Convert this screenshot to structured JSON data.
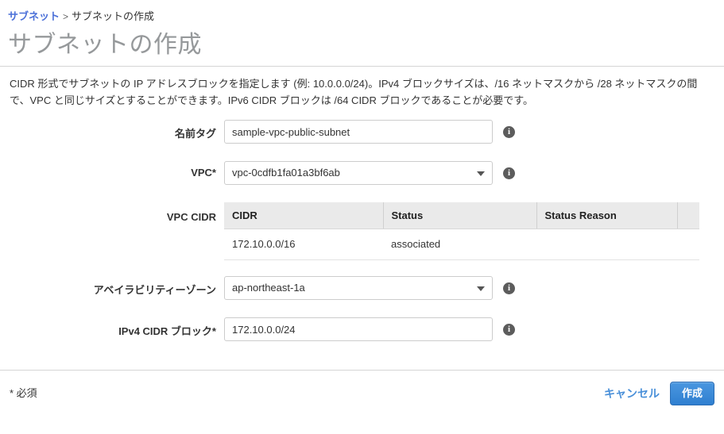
{
  "breadcrumb": {
    "parent_label": "サブネット",
    "separator": ">",
    "current_label": "サブネットの作成"
  },
  "page": {
    "title": "サブネットの作成",
    "description": "CIDR 形式でサブネットの IP アドレスブロックを指定します (例: 10.0.0.0/24)。IPv4 ブロックサイズは、/16 ネットマスクから /28 ネットマスクの間で、VPC と同じサイズとすることができます。IPv6 CIDR ブロックは /64 CIDR ブロックであることが必要です。"
  },
  "form": {
    "name_tag": {
      "label": "名前タグ",
      "value": "sample-vpc-public-subnet",
      "placeholder": "",
      "info": "i"
    },
    "vpc": {
      "label": "VPC*",
      "value": "vpc-0cdfb1fa01a3bf6ab",
      "info": "i"
    },
    "vpc_cidr": {
      "label": "VPC CIDR"
    },
    "availability_zone": {
      "label": "アベイラビリティーゾーン",
      "value": "ap-northeast-1a",
      "info": "i"
    },
    "ipv4_cidr_block": {
      "label": "IPv4 CIDR ブロック*",
      "value": "172.10.0.0/24",
      "placeholder": "",
      "info": "i"
    }
  },
  "cidr_table": {
    "columns": [
      "CIDR",
      "Status",
      "Status Reason",
      ""
    ],
    "rows": [
      {
        "cidr": "172.10.0.0/16",
        "status": "associated",
        "status_reason": "",
        "extra": ""
      }
    ]
  },
  "footer": {
    "required_note": "* 必須",
    "cancel_label": "キャンセル",
    "create_label": "作成"
  },
  "colors": {
    "link_blue": "#4a6fd8",
    "cancel_blue": "#4a90d9",
    "button_blue": "#2f7fd0",
    "title_gray": "#96999b",
    "status_green": "#1b8c3b",
    "table_header_gray": "#eaeaea",
    "border_gray": "#cccccc"
  }
}
